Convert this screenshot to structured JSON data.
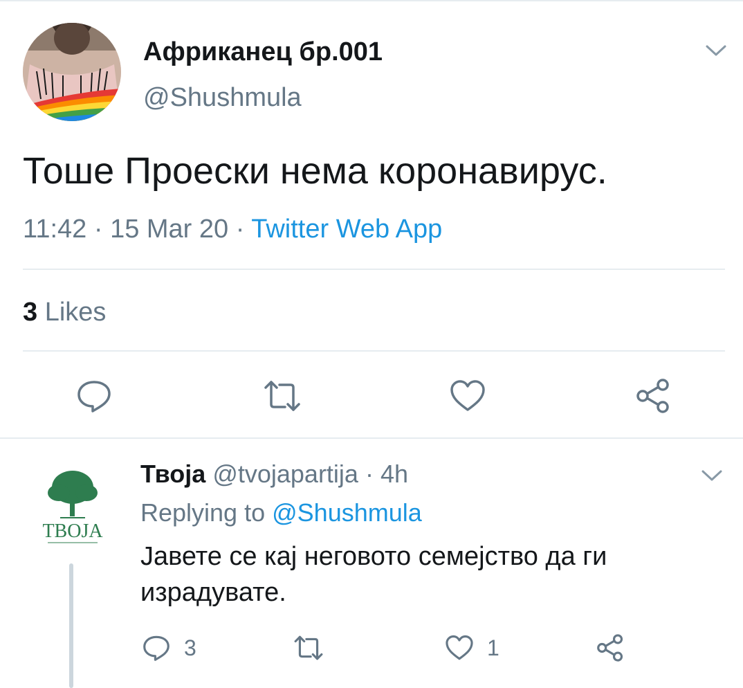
{
  "main_tweet": {
    "display_name": "Африканец бр.001",
    "handle": "@Shushmula",
    "text": "Тоше Проески нема коронавирус.",
    "time": "11:42",
    "date": "15 Mar 20",
    "separator": "·",
    "source": "Twitter Web App",
    "likes_count": "3",
    "likes_label": "Likes",
    "icons": [
      "reply-icon",
      "retweet-icon",
      "like-icon",
      "share-icon",
      "chevron-down-icon"
    ]
  },
  "reply": {
    "display_name": "Твоја",
    "handle": "@tvojapartija",
    "separator": "·",
    "age": "4h",
    "replying_prefix": "Replying to",
    "replying_to": "@Shushmula",
    "text": "Јавете се кај неговото семејство да ги израдувате.",
    "avatar_logo_text": "ТВОЈА",
    "reply_count": "3",
    "like_count": "1"
  },
  "colors": {
    "accent": "#1b95e0",
    "secondary_text": "#657786",
    "divider": "#e6ecf0",
    "tree_green": "#2e7d4f"
  }
}
